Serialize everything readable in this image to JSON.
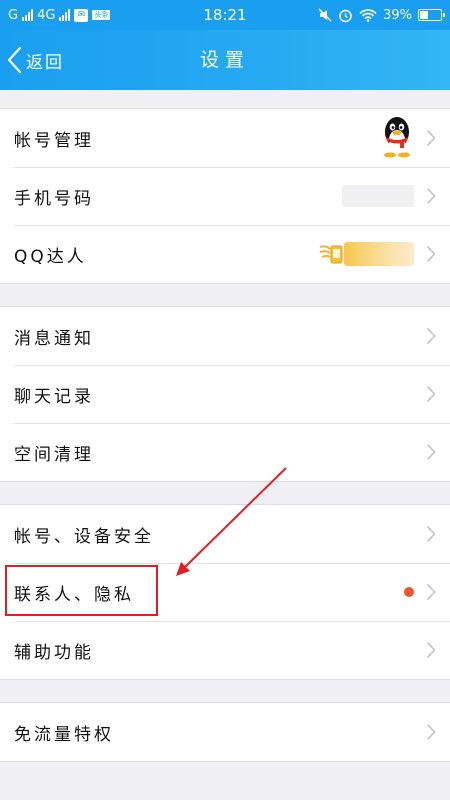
{
  "statusbar": {
    "carrier": "G",
    "network": "4G",
    "box_label": "",
    "badge_label": "头条",
    "time": "18:21",
    "battery": "39%"
  },
  "navbar": {
    "back_label": "返回",
    "title": "设置"
  },
  "groups": [
    {
      "items": [
        {
          "label": "帐号管理",
          "accessory": "penguin-avatar"
        },
        {
          "label": "手机号码",
          "accessory": "redacted-value"
        },
        {
          "label": "QQ达人",
          "accessory": "qq-daren-badge"
        }
      ]
    },
    {
      "items": [
        {
          "label": "消息通知"
        },
        {
          "label": "聊天记录"
        },
        {
          "label": "空间清理"
        }
      ]
    },
    {
      "items": [
        {
          "label": "帐号、设备安全"
        },
        {
          "label": "联系人、隐私",
          "accessory": "red-dot",
          "highlighted": true
        },
        {
          "label": "辅助功能"
        }
      ]
    },
    {
      "items": [
        {
          "label": "免流量特权"
        }
      ]
    }
  ],
  "colors": {
    "accent": "#1a9ff0",
    "highlight_red": "#e02020",
    "notification_dot": "#f0552b",
    "background": "#efeff4"
  }
}
